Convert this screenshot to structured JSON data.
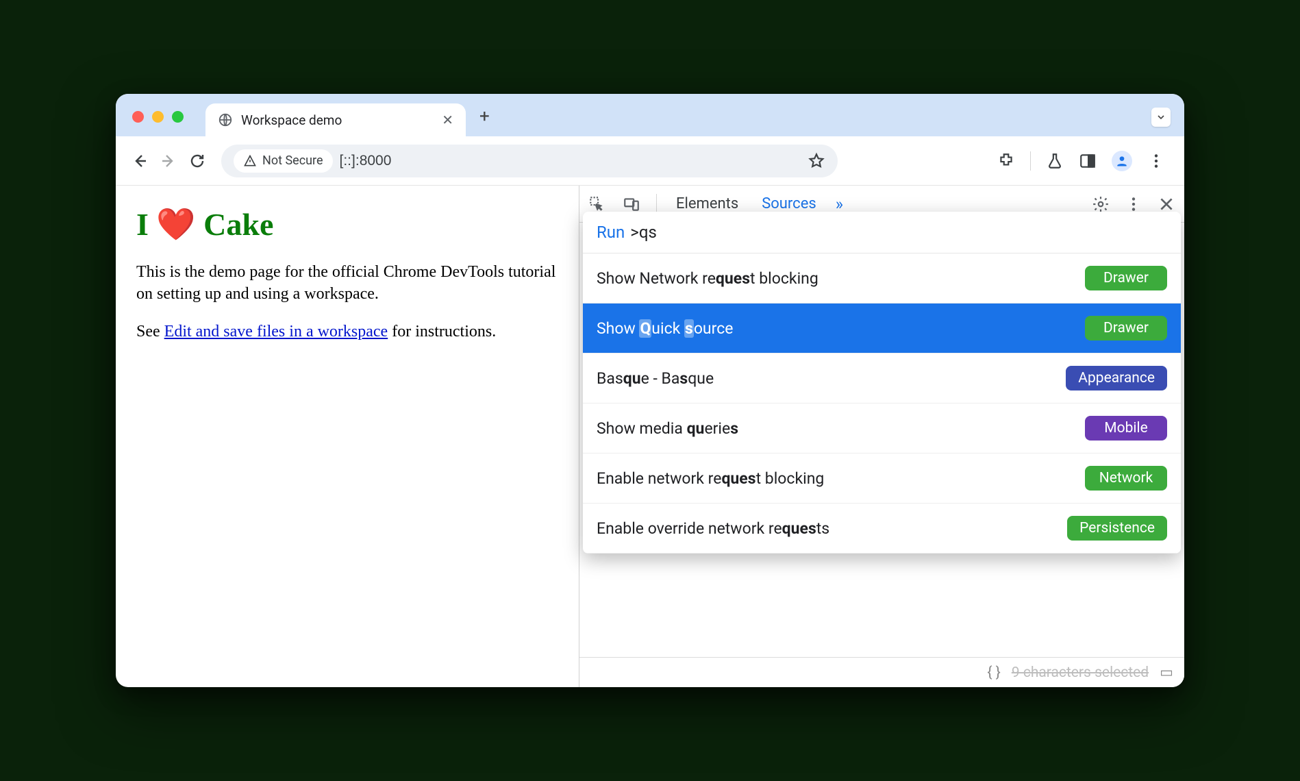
{
  "tab": {
    "title": "Workspace demo"
  },
  "addr": {
    "security_label": "Not Secure",
    "url": "[::]:8000"
  },
  "page": {
    "heading": "I ❤️ Cake",
    "p1": "This is the demo page for the official Chrome DevTools tutorial on setting up and using a workspace.",
    "see_prefix": "See ",
    "link_text": "Edit and save files in a workspace",
    "see_suffix": " for instructions."
  },
  "devtools": {
    "tabs": {
      "elements": "Elements",
      "sources": "Sources"
    },
    "status": "9 characters selected"
  },
  "cmd": {
    "run_label": "Run",
    "query": ">qs",
    "items": [
      {
        "label_pre": "Show Network re",
        "label_hl1": "que",
        "label_mid": "",
        "label_hl2": "s",
        "label_post": "t blocking",
        "badge": "Drawer",
        "badge_color": "green",
        "selected": false
      },
      {
        "label_pre": "Show ",
        "label_hl1": "Q",
        "label_mid": "uick ",
        "label_hl2": "s",
        "label_post": "ource",
        "badge": "Drawer",
        "badge_color": "green",
        "selected": true
      },
      {
        "label_pre": "Bas",
        "label_hl1": "qu",
        "label_mid": "e - Ba",
        "label_hl2": "s",
        "label_post": "que",
        "badge": "Appearance",
        "badge_color": "blue",
        "selected": false
      },
      {
        "label_pre": "Show media ",
        "label_hl1": "qu",
        "label_mid": "erie",
        "label_hl2": "s",
        "label_post": "",
        "badge": "Mobile",
        "badge_color": "purple",
        "selected": false
      },
      {
        "label_pre": "Enable network re",
        "label_hl1": "que",
        "label_mid": "",
        "label_hl2": "s",
        "label_post": "t blocking",
        "badge": "Network",
        "badge_color": "green",
        "selected": false
      },
      {
        "label_pre": "Enable override network re",
        "label_hl1": "que",
        "label_mid": "",
        "label_hl2": "s",
        "label_post": "ts",
        "badge": "Persistence",
        "badge_color": "green",
        "selected": false
      }
    ]
  }
}
